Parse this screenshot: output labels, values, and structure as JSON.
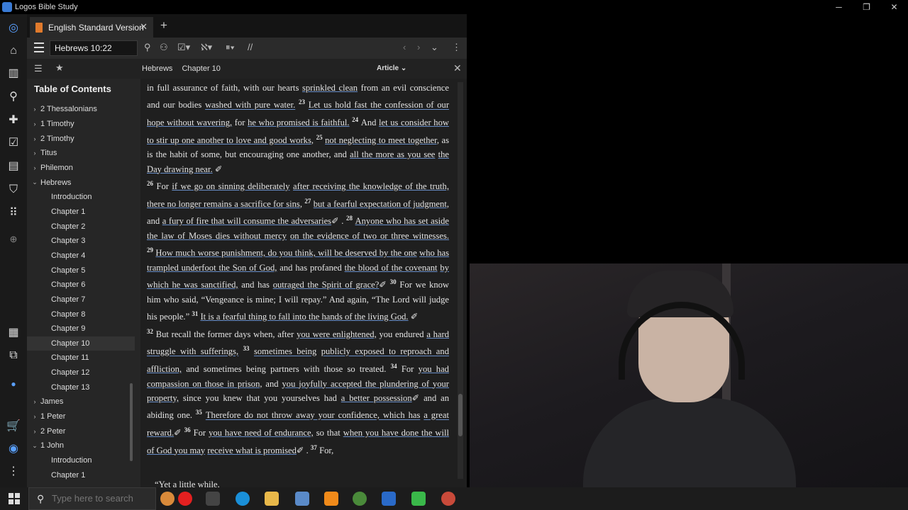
{
  "window": {
    "title": "Logos Bible Study",
    "minimize": "─",
    "maximize": "❐",
    "close": "✕"
  },
  "tab": {
    "label": "English Standard Version",
    "close": "✕",
    "new_tab": "+"
  },
  "toolbar": {
    "reference": "Hebrews 10:22"
  },
  "sidebar": {
    "title": "Table of Contents",
    "items": [
      {
        "label": "2 Thessalonians",
        "level": 0,
        "chevron": "›"
      },
      {
        "label": "1 Timothy",
        "level": 0,
        "chevron": "›"
      },
      {
        "label": "2 Timothy",
        "level": 0,
        "chevron": "›"
      },
      {
        "label": "Titus",
        "level": 0,
        "chevron": "›"
      },
      {
        "label": "Philemon",
        "level": 0,
        "chevron": "›"
      },
      {
        "label": "Hebrews",
        "level": 0,
        "chevron": "⌄"
      },
      {
        "label": "Introduction",
        "level": 1
      },
      {
        "label": "Chapter 1",
        "level": 1
      },
      {
        "label": "Chapter 2",
        "level": 1
      },
      {
        "label": "Chapter 3",
        "level": 1
      },
      {
        "label": "Chapter 4",
        "level": 1
      },
      {
        "label": "Chapter 5",
        "level": 1
      },
      {
        "label": "Chapter 6",
        "level": 1
      },
      {
        "label": "Chapter 7",
        "level": 1
      },
      {
        "label": "Chapter 8",
        "level": 1
      },
      {
        "label": "Chapter 9",
        "level": 1
      },
      {
        "label": "Chapter 10",
        "level": 1,
        "active": true
      },
      {
        "label": "Chapter 11",
        "level": 1
      },
      {
        "label": "Chapter 12",
        "level": 1
      },
      {
        "label": "Chapter 13",
        "level": 1
      },
      {
        "label": "James",
        "level": 0,
        "chevron": "›"
      },
      {
        "label": "1 Peter",
        "level": 0,
        "chevron": "›"
      },
      {
        "label": "2 Peter",
        "level": 0,
        "chevron": "›"
      },
      {
        "label": "1 John",
        "level": 0,
        "chevron": "⌄"
      },
      {
        "label": "Introduction",
        "level": 1
      },
      {
        "label": "Chapter 1",
        "level": 1
      }
    ]
  },
  "reader": {
    "breadcrumb": [
      "Hebrews",
      "Chapter 10"
    ],
    "view_mode": "Article",
    "paragraphs": [
      [
        {
          "t": "in full assurance of faith, with our hearts "
        },
        {
          "u": "sprinkled clean"
        },
        {
          "t": " from an evil conscience and our bodies "
        },
        {
          "u": "washed with pure water."
        },
        {
          "v": "23"
        },
        {
          "u": "Let us hold fast the confession of our hope without wavering,"
        },
        {
          "t": " for "
        },
        {
          "u": "he who promised is faithful."
        },
        {
          "v": "24"
        },
        {
          "t": "And "
        },
        {
          "u": "let us consider how to stir up one another to love and good works,"
        },
        {
          "v": "25"
        },
        {
          "u": "not neglecting to meet together,"
        },
        {
          "t": " as is the habit of some, but encouraging one another, and "
        },
        {
          "u": "all the more as you see"
        },
        {
          "t": " "
        },
        {
          "u": "the Day drawing near."
        },
        {
          "t": " ✐"
        }
      ],
      [
        {
          "v": "26"
        },
        {
          "t": "For "
        },
        {
          "u": "if we go on sinning deliberately"
        },
        {
          "t": " "
        },
        {
          "u": "after receiving the knowledge of the truth,"
        },
        {
          "t": " "
        },
        {
          "u": "there no longer remains a sacrifice for sins,"
        },
        {
          "v": "27"
        },
        {
          "u": "but a fearful expectation of judgment,"
        },
        {
          "t": " and "
        },
        {
          "u": "a fury of fire that will consume the adversaries"
        },
        {
          "t": "✐ ."
        },
        {
          "v": "28"
        },
        {
          "u": "Anyone who has set aside the law of Moses dies without mercy"
        },
        {
          "t": " "
        },
        {
          "u": "on the evidence of two or three witnesses."
        },
        {
          "v": "29"
        },
        {
          "u": "How much worse punishment, do you think, will be deserved by the one"
        },
        {
          "t": " "
        },
        {
          "u": "who has trampled underfoot the Son of God,"
        },
        {
          "t": " and has profaned "
        },
        {
          "u": "the blood of the covenant"
        },
        {
          "t": " "
        },
        {
          "u": "by which he was sanctified,"
        },
        {
          "t": " and has "
        },
        {
          "u": "outraged the Spirit of grace?"
        },
        {
          "t": "✐"
        },
        {
          "v": "30"
        },
        {
          "t": "For we know him who said, "
        },
        {
          "t": "“Vengeance is mine; I will repay.” And again, "
        },
        {
          "t": "“The Lord will judge his people.”"
        },
        {
          "v": "31"
        },
        {
          "u": "It is a fearful thing to fall into the hands of the living God."
        },
        {
          "t": " ✐"
        }
      ],
      [
        {
          "v": "32"
        },
        {
          "t": "But recall the former days when, after "
        },
        {
          "u": "you were enlightened,"
        },
        {
          "t": " you endured "
        },
        {
          "u": "a hard struggle with sufferings,"
        },
        {
          "v": "33"
        },
        {
          "u": "sometimes being"
        },
        {
          "t": " "
        },
        {
          "u": "publicly exposed to reproach and affliction,"
        },
        {
          "t": " and sometimes being partners with those so treated."
        },
        {
          "v": "34"
        },
        {
          "t": "For "
        },
        {
          "u": "you had compassion on those in prison,"
        },
        {
          "t": " and "
        },
        {
          "u": "you joyfully accepted the plundering of your property,"
        },
        {
          "t": " since you knew that you yourselves had "
        },
        {
          "u": "a better possession"
        },
        {
          "t": "✐ and an abiding one."
        },
        {
          "v": "35"
        },
        {
          "u": "Therefore do not throw away your confidence, which has"
        },
        {
          "t": " "
        },
        {
          "u": "a great reward."
        },
        {
          "t": "✐"
        },
        {
          "v": "36"
        },
        {
          "t": "For "
        },
        {
          "u": "you have need of endurance,"
        },
        {
          "t": " so that "
        },
        {
          "u": "when you have done the will of God you may"
        },
        {
          "t": " "
        },
        {
          "u": "receive what is promised"
        },
        {
          "t": "✐ ."
        },
        {
          "v": "37"
        },
        {
          "t": "For,"
        }
      ]
    ],
    "quote_line": "“Yet a little while,"
  },
  "taskbar": {
    "search_placeholder": "Type here to search"
  },
  "colors": {
    "accent": "#3a7bd5",
    "tab_book": "#e07a2c",
    "link_underline": "#6a8fc9"
  }
}
